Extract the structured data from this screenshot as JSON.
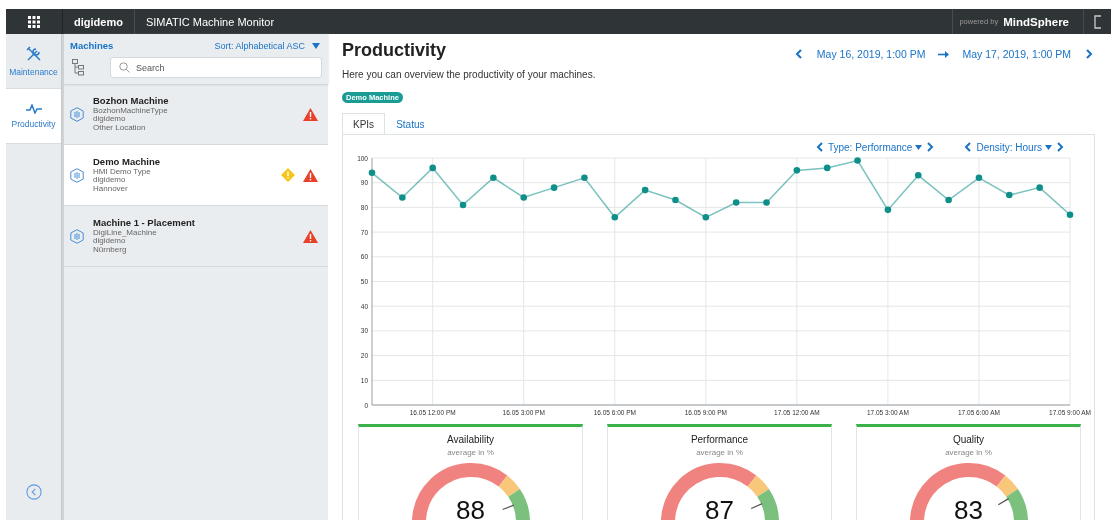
{
  "top_bar": {
    "org": "digidemo",
    "app_title": "SIMATIC Machine Monitor",
    "powered_by": "powered by",
    "brand": "MindSphere"
  },
  "nav": [
    {
      "label": "Maintenance",
      "selected": false
    },
    {
      "label": "Productivity",
      "selected": true
    }
  ],
  "machines_panel": {
    "title": "Machines",
    "sort": "Sort:  Alphabetical ASC",
    "search": {
      "placeholder": "Search"
    },
    "machines": [
      {
        "name": "Bozhon Machine",
        "type": "BozhonMachineType",
        "tenant": "digidemo",
        "location": "Other Location",
        "alerts": [
          {
            "kind": "error"
          }
        ],
        "selected": false
      },
      {
        "name": "Demo Machine",
        "type": "HMI Demo Type",
        "tenant": "digidemo",
        "location": "Hannover",
        "alerts": [
          {
            "kind": "warning"
          },
          {
            "kind": "error"
          }
        ],
        "selected": true
      },
      {
        "name": "Machine 1 - Placement",
        "type": "DigiLine_Machine",
        "tenant": "digidemo",
        "location": "Nürnberg",
        "alerts": [
          {
            "kind": "error"
          }
        ],
        "selected": false
      }
    ]
  },
  "page": {
    "title": "Productivity",
    "date_from": "May 16, 2019, 1:00 PM",
    "date_to": "May 17, 2019, 1:00 PM",
    "description": "Here you can overview the productivity of your machines.",
    "badge": "Demo Machine",
    "tabs": [
      {
        "label": "KPIs",
        "selected": true
      },
      {
        "label": "Status",
        "selected": false
      }
    ],
    "type_selector": "Type: Performance",
    "density_selector": "Density: Hours",
    "chart_data": {
      "type": "line",
      "categories": [
        null,
        null,
        "16.05 12:00 PM",
        null,
        null,
        "16.05 3:00 PM",
        null,
        null,
        "16.05 6:00 PM",
        null,
        null,
        "16.05 9:00 PM",
        null,
        null,
        "17.05 12:00 AM",
        null,
        null,
        "17.05 3:00 AM",
        null,
        null,
        "17.05 6:00 AM",
        null,
        null,
        "17.05 9:00 AM"
      ],
      "grid": true,
      "series": [
        {
          "color": "#0f8f8a",
          "marker": "o",
          "values": [
            94,
            84,
            96,
            81,
            92,
            84,
            88,
            92,
            76,
            87,
            83,
            76,
            82,
            82,
            95,
            96,
            99,
            79,
            93,
            83,
            92,
            85,
            88,
            77
          ]
        }
      ],
      "ylim": [
        0,
        100
      ],
      "yticks": [
        0,
        10,
        20,
        30,
        40,
        50,
        60,
        70,
        80,
        90,
        100
      ]
    },
    "gauges": [
      {
        "title": "Availability",
        "subtitle": "average in %",
        "value": "88"
      },
      {
        "title": "Performance",
        "subtitle": "average in %",
        "value": "87"
      },
      {
        "title": "Quality",
        "subtitle": "average in %",
        "value": "83"
      }
    ]
  }
}
